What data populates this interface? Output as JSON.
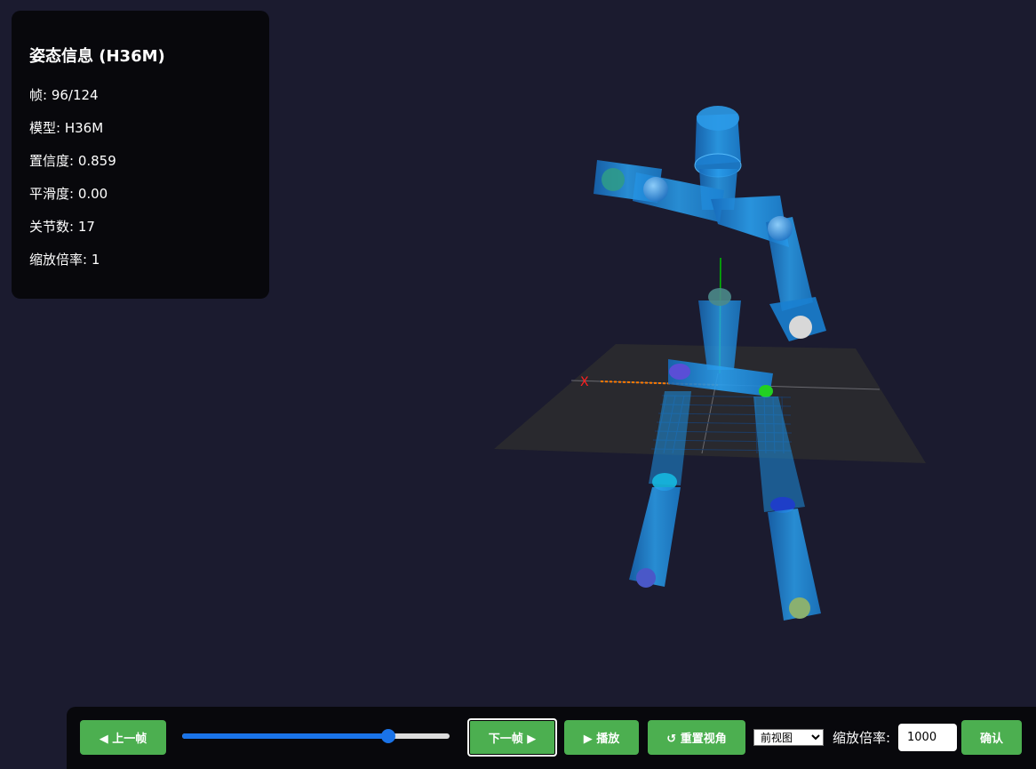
{
  "info": {
    "title": "姿态信息 (H36M)",
    "frame": "帧: 96/124",
    "model": "模型: H36M",
    "confidence": "置信度: 0.859",
    "smoothness": "平滑度: 0.00",
    "joint_count": "关节数: 17",
    "zoom_rate": "缩放倍率: 1"
  },
  "playback": {
    "current_frame": 96,
    "total_frames": 124
  },
  "controls": {
    "prev_label": "◀ 上一帧",
    "next_label": "下一帧 ▶",
    "play_label": "▶ 播放",
    "reset_label": "↺ 重置视角",
    "view_selected": "前视图",
    "zoom_label": "缩放倍率:",
    "zoom_value": "1000",
    "confirm_label": "确认"
  },
  "scene": {
    "axis_x_label": "X"
  },
  "colors": {
    "background": "#1b1b2f",
    "panel": "#08080c",
    "button": "#4caf50",
    "limb": "#1e90e0",
    "slider": "#1a73e8"
  },
  "icons": [
    "prev-arrow-icon",
    "next-arrow-icon",
    "play-icon",
    "reset-icon",
    "chevron-down-icon"
  ]
}
